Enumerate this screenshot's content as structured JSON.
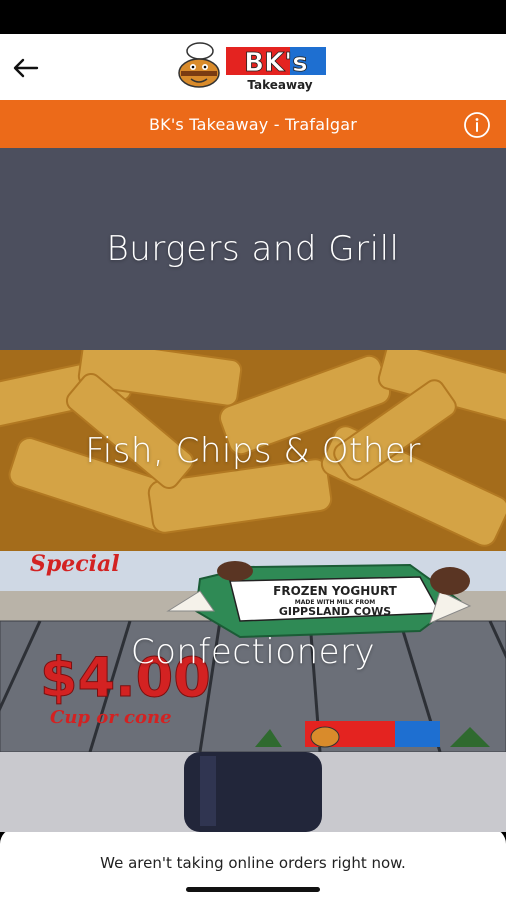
{
  "header": {
    "back_icon": "arrow-left-icon",
    "logo": {
      "brand": "BK's",
      "subtitle": "Takeaway"
    }
  },
  "store_bar": {
    "name": "BK's Takeaway - Trafalgar",
    "info_icon": "info-circle-icon",
    "color": "#ec6a19"
  },
  "categories": [
    {
      "label": "Burgers and Grill"
    },
    {
      "label": "Fish, Chips & Other"
    },
    {
      "label": "Confectionery",
      "promo": {
        "special": "Special",
        "price": "$4.00",
        "cup_or_cone": "Cup or cone",
        "headline": "FROZEN YOGHURT",
        "subline": "MADE WITH MILK FROM",
        "source": "GIPPSLAND COWS"
      }
    },
    {
      "label": ""
    }
  ],
  "footer": {
    "message": "We aren't taking online orders right now."
  }
}
